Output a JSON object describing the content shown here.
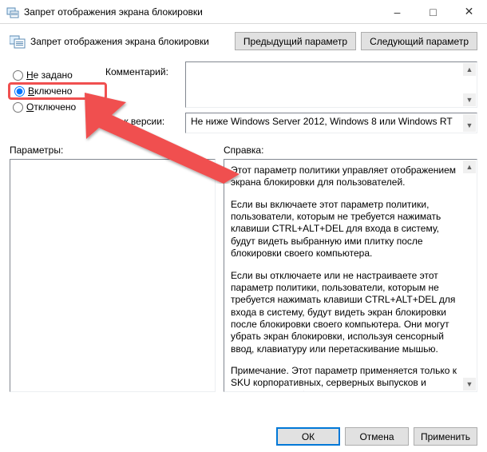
{
  "titlebar": {
    "text": "Запрет отображения экрана блокировки"
  },
  "header": {
    "title": "Запрет отображения экрана блокировки",
    "prev": "Предыдущий параметр",
    "next": "Следующий параметр"
  },
  "radios": {
    "not_configured_pre": "Н",
    "not_configured_rest": "е задано",
    "enabled_pre": "В",
    "enabled_rest": "ключено",
    "disabled_pre": "О",
    "disabled_rest": "тключено"
  },
  "labels": {
    "comment": "Комментарий:",
    "version_pre": "Тре",
    "version_rest": "           к версии:",
    "parameters": "Параметры:",
    "help": "Справка:"
  },
  "version_text": "Не ниже Windows Server 2012, Windows 8 или Windows RT",
  "help": {
    "p1": "Этот параметр политики управляет отображением экрана блокировки для пользователей.",
    "p2": "Если вы включаете этот параметр политики, пользователи, которым не требуется нажимать клавиши CTRL+ALT+DEL для входа в систему, будут видеть выбранную ими плитку после блокировки своего компьютера.",
    "p3": "Если вы отключаете или не настраиваете этот параметр политики, пользователи, которым не требуется нажимать клавиши CTRL+ALT+DEL для входа в систему, будут видеть экран блокировки после блокировки своего компьютера. Они могут убрать экран блокировки, используя сенсорный ввод, клавиатуру или перетаскивание мышью.",
    "p4": "Примечание. Этот параметр применяется только к SKU корпоративных, серверных выпусков и выпусков для образовательных учреждений."
  },
  "footer": {
    "ok": "ОК",
    "cancel": "Отмена",
    "apply": "Применить"
  }
}
